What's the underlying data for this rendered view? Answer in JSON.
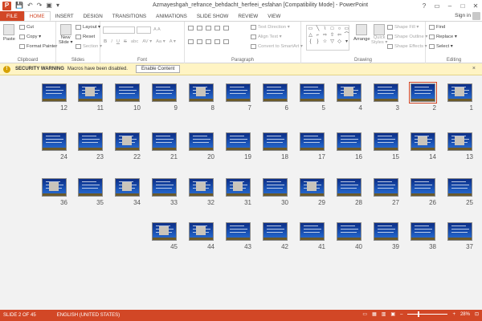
{
  "window": {
    "title": "Azmayeshgah_refrance_behdacht_herfeei_esfahan [Compatibility Mode] - PowerPoint",
    "qat": [
      "P",
      "💾",
      "↶",
      "↷",
      "▣",
      "▾"
    ],
    "controls": [
      "?",
      "▭",
      "–",
      "□",
      "✕"
    ]
  },
  "tabs": {
    "file": "FILE",
    "items": [
      "HOME",
      "INSERT",
      "DESIGN",
      "TRANSITIONS",
      "ANIMATIONS",
      "SLIDE SHOW",
      "REVIEW",
      "VIEW"
    ],
    "active": "HOME",
    "signin": "Sign in"
  },
  "ribbon": {
    "clipboard": {
      "label": "Clipboard",
      "paste": "Paste",
      "cut": "Cut",
      "copy": "Copy ▾",
      "format_painter": "Format Painter"
    },
    "slides": {
      "label": "Slides",
      "new_slide": "New",
      "new_slide2": "Slide ▾",
      "layout": "Layout ▾",
      "reset": "Reset",
      "section": "Section ▾"
    },
    "font": {
      "label": "Font",
      "size": "A A",
      "bold": "B",
      "italic": "I",
      "underline": "U",
      "strike": "S",
      "shadow": "abc",
      "spacing": "AV ▾",
      "case": "Aa ▾",
      "color": "A ▾"
    },
    "paragraph": {
      "label": "Paragraph",
      "text_direction": "Text Direction ▾",
      "align_text": "Align Text ▾",
      "convert_smartart": "Convert to SmartArt ▾"
    },
    "drawing": {
      "label": "Drawing",
      "arrange": "Arrange",
      "quick_styles": "Quick",
      "quick_styles2": "Styles ▾",
      "shape_fill": "Shape Fill ▾",
      "shape_outline": "Shape Outline ▾",
      "shape_effects": "Shape Effects ▾",
      "shapes": [
        "▭",
        "╲",
        "\\",
        "□",
        "○",
        "▭",
        "△",
        "⌐",
        "⇨",
        "⇧",
        "⇦",
        "⌒",
        "{",
        "}",
        "☆",
        "▽",
        "◇",
        "▾"
      ]
    },
    "editing": {
      "label": "Editing",
      "find": "Find",
      "replace": "Replace ▾",
      "select": "Select ▾"
    }
  },
  "security": {
    "title": "SECURITY WARNING",
    "message": "Macros have been disabled.",
    "enable": "Enable Content",
    "close": "×"
  },
  "slides": [
    {
      "n": "12",
      "photo": false
    },
    {
      "n": "11",
      "photo": true
    },
    {
      "n": "10",
      "photo": false
    },
    {
      "n": "9",
      "photo": false
    },
    {
      "n": "8",
      "photo": true
    },
    {
      "n": "7",
      "photo": false
    },
    {
      "n": "6",
      "photo": false
    },
    {
      "n": "5",
      "photo": false
    },
    {
      "n": "4",
      "photo": true
    },
    {
      "n": "3",
      "photo": false
    },
    {
      "n": "2",
      "photo": false
    },
    {
      "n": "1",
      "photo": true
    },
    {
      "n": "24",
      "photo": false
    },
    {
      "n": "23",
      "photo": false
    },
    {
      "n": "22",
      "photo": true
    },
    {
      "n": "21",
      "photo": false
    },
    {
      "n": "20",
      "photo": false
    },
    {
      "n": "19",
      "photo": false
    },
    {
      "n": "18",
      "photo": false
    },
    {
      "n": "17",
      "photo": false
    },
    {
      "n": "16",
      "photo": false
    },
    {
      "n": "15",
      "photo": false
    },
    {
      "n": "14",
      "photo": true
    },
    {
      "n": "13",
      "photo": true
    },
    {
      "n": "36",
      "photo": true
    },
    {
      "n": "35",
      "photo": false
    },
    {
      "n": "34",
      "photo": true
    },
    {
      "n": "33",
      "photo": false
    },
    {
      "n": "32",
      "photo": true
    },
    {
      "n": "31",
      "photo": true
    },
    {
      "n": "30",
      "photo": false
    },
    {
      "n": "29",
      "photo": true
    },
    {
      "n": "28",
      "photo": false
    },
    {
      "n": "27",
      "photo": false
    },
    {
      "n": "26",
      "photo": false
    },
    {
      "n": "25",
      "photo": false
    },
    {
      "n": "45",
      "photo": true
    },
    {
      "n": "44",
      "photo": true
    },
    {
      "n": "43",
      "photo": false
    },
    {
      "n": "42",
      "photo": false
    },
    {
      "n": "41",
      "photo": false
    },
    {
      "n": "40",
      "photo": false
    },
    {
      "n": "39",
      "photo": false
    },
    {
      "n": "38",
      "photo": false
    },
    {
      "n": "37",
      "photo": false
    }
  ],
  "selected_slide": "2",
  "status": {
    "slide": "SLIDE 2 OF 45",
    "language": "ENGLISH (UNITED STATES)",
    "zoom": "28%",
    "zoom_level": 0.28,
    "view_icons": [
      "▭",
      "▦",
      "▥",
      "▣"
    ],
    "minus": "–",
    "plus": "+",
    "fit": "⊡"
  },
  "colors": {
    "accent": "#d24726",
    "warning_bg": "#fff4c4",
    "slide_bg": "#1b55b8"
  }
}
